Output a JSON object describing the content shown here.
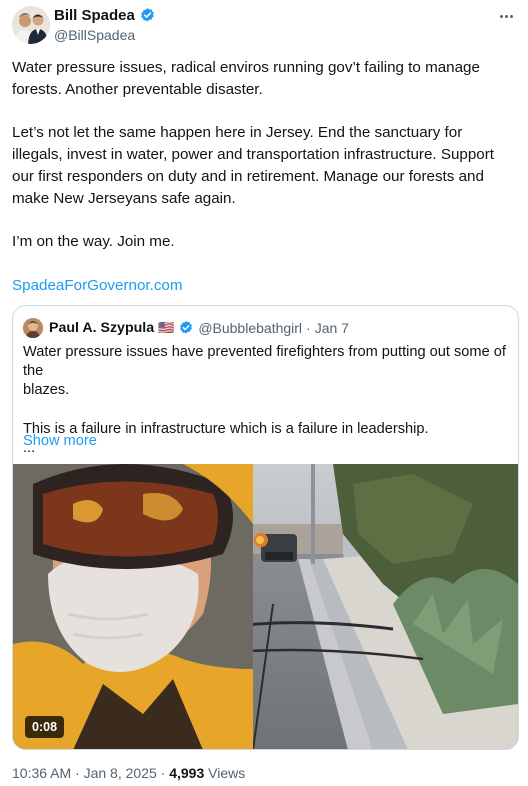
{
  "tweet": {
    "author": {
      "name": "Bill Spadea",
      "handle": "@BillSpadea",
      "verified": true,
      "avatar_icon": "avatar-photo"
    },
    "text_lines": [
      "Water pressure issues, radical enviros running gov’t failing to manage",
      "forests. Another preventable disaster.",
      "Let’s not let the same happen here in Jersey. End the sanctuary for",
      "illegals, invest in water, power and transportation infrastructure. Support",
      "our first responders on duty and in retirement. Manage our forests and",
      "make New Jerseyans safe again.",
      "I’m on the way. Join me."
    ],
    "link": "SpadeaForGovernor.com",
    "timestamp": "10:36 AM · Jan 8, 2025 · ",
    "views_count": "4,993",
    "views_label": " Views"
  },
  "quoted": {
    "name": "Paul A. Szypula",
    "flag": "🇺🇸",
    "handle": "@Bubblebathgirl",
    "dot": "·",
    "date": "Jan 7",
    "text_lines": [
      "Water pressure issues have prevented firefighters from putting out some of the",
      "blazes.",
      "This is a failure in infrastructure which is a failure in leadership.",
      "..."
    ],
    "show_more": "Show more",
    "video": {
      "duration": "0:08"
    }
  },
  "colors": {
    "accent": "#1d9bf0",
    "text": "#0f1419",
    "muted": "#536471",
    "border": "#cfd9de"
  }
}
